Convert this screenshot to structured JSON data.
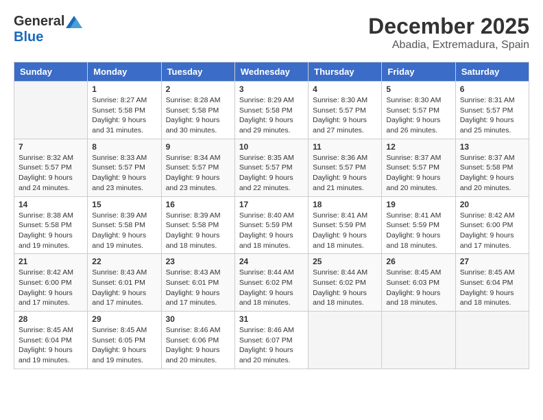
{
  "logo": {
    "general": "General",
    "blue": "Blue"
  },
  "title": "December 2025",
  "location": "Abadia, Extremadura, Spain",
  "headers": [
    "Sunday",
    "Monday",
    "Tuesday",
    "Wednesday",
    "Thursday",
    "Friday",
    "Saturday"
  ],
  "weeks": [
    [
      {
        "day": "",
        "info": ""
      },
      {
        "day": "1",
        "info": "Sunrise: 8:27 AM\nSunset: 5:58 PM\nDaylight: 9 hours\nand 31 minutes."
      },
      {
        "day": "2",
        "info": "Sunrise: 8:28 AM\nSunset: 5:58 PM\nDaylight: 9 hours\nand 30 minutes."
      },
      {
        "day": "3",
        "info": "Sunrise: 8:29 AM\nSunset: 5:58 PM\nDaylight: 9 hours\nand 29 minutes."
      },
      {
        "day": "4",
        "info": "Sunrise: 8:30 AM\nSunset: 5:57 PM\nDaylight: 9 hours\nand 27 minutes."
      },
      {
        "day": "5",
        "info": "Sunrise: 8:30 AM\nSunset: 5:57 PM\nDaylight: 9 hours\nand 26 minutes."
      },
      {
        "day": "6",
        "info": "Sunrise: 8:31 AM\nSunset: 5:57 PM\nDaylight: 9 hours\nand 25 minutes."
      }
    ],
    [
      {
        "day": "7",
        "info": "Sunrise: 8:32 AM\nSunset: 5:57 PM\nDaylight: 9 hours\nand 24 minutes."
      },
      {
        "day": "8",
        "info": "Sunrise: 8:33 AM\nSunset: 5:57 PM\nDaylight: 9 hours\nand 23 minutes."
      },
      {
        "day": "9",
        "info": "Sunrise: 8:34 AM\nSunset: 5:57 PM\nDaylight: 9 hours\nand 23 minutes."
      },
      {
        "day": "10",
        "info": "Sunrise: 8:35 AM\nSunset: 5:57 PM\nDaylight: 9 hours\nand 22 minutes."
      },
      {
        "day": "11",
        "info": "Sunrise: 8:36 AM\nSunset: 5:57 PM\nDaylight: 9 hours\nand 21 minutes."
      },
      {
        "day": "12",
        "info": "Sunrise: 8:37 AM\nSunset: 5:57 PM\nDaylight: 9 hours\nand 20 minutes."
      },
      {
        "day": "13",
        "info": "Sunrise: 8:37 AM\nSunset: 5:58 PM\nDaylight: 9 hours\nand 20 minutes."
      }
    ],
    [
      {
        "day": "14",
        "info": "Sunrise: 8:38 AM\nSunset: 5:58 PM\nDaylight: 9 hours\nand 19 minutes."
      },
      {
        "day": "15",
        "info": "Sunrise: 8:39 AM\nSunset: 5:58 PM\nDaylight: 9 hours\nand 19 minutes."
      },
      {
        "day": "16",
        "info": "Sunrise: 8:39 AM\nSunset: 5:58 PM\nDaylight: 9 hours\nand 18 minutes."
      },
      {
        "day": "17",
        "info": "Sunrise: 8:40 AM\nSunset: 5:59 PM\nDaylight: 9 hours\nand 18 minutes."
      },
      {
        "day": "18",
        "info": "Sunrise: 8:41 AM\nSunset: 5:59 PM\nDaylight: 9 hours\nand 18 minutes."
      },
      {
        "day": "19",
        "info": "Sunrise: 8:41 AM\nSunset: 5:59 PM\nDaylight: 9 hours\nand 18 minutes."
      },
      {
        "day": "20",
        "info": "Sunrise: 8:42 AM\nSunset: 6:00 PM\nDaylight: 9 hours\nand 17 minutes."
      }
    ],
    [
      {
        "day": "21",
        "info": "Sunrise: 8:42 AM\nSunset: 6:00 PM\nDaylight: 9 hours\nand 17 minutes."
      },
      {
        "day": "22",
        "info": "Sunrise: 8:43 AM\nSunset: 6:01 PM\nDaylight: 9 hours\nand 17 minutes."
      },
      {
        "day": "23",
        "info": "Sunrise: 8:43 AM\nSunset: 6:01 PM\nDaylight: 9 hours\nand 17 minutes."
      },
      {
        "day": "24",
        "info": "Sunrise: 8:44 AM\nSunset: 6:02 PM\nDaylight: 9 hours\nand 18 minutes."
      },
      {
        "day": "25",
        "info": "Sunrise: 8:44 AM\nSunset: 6:02 PM\nDaylight: 9 hours\nand 18 minutes."
      },
      {
        "day": "26",
        "info": "Sunrise: 8:45 AM\nSunset: 6:03 PM\nDaylight: 9 hours\nand 18 minutes."
      },
      {
        "day": "27",
        "info": "Sunrise: 8:45 AM\nSunset: 6:04 PM\nDaylight: 9 hours\nand 18 minutes."
      }
    ],
    [
      {
        "day": "28",
        "info": "Sunrise: 8:45 AM\nSunset: 6:04 PM\nDaylight: 9 hours\nand 19 minutes."
      },
      {
        "day": "29",
        "info": "Sunrise: 8:45 AM\nSunset: 6:05 PM\nDaylight: 9 hours\nand 19 minutes."
      },
      {
        "day": "30",
        "info": "Sunrise: 8:46 AM\nSunset: 6:06 PM\nDaylight: 9 hours\nand 20 minutes."
      },
      {
        "day": "31",
        "info": "Sunrise: 8:46 AM\nSunset: 6:07 PM\nDaylight: 9 hours\nand 20 minutes."
      },
      {
        "day": "",
        "info": ""
      },
      {
        "day": "",
        "info": ""
      },
      {
        "day": "",
        "info": ""
      }
    ]
  ]
}
